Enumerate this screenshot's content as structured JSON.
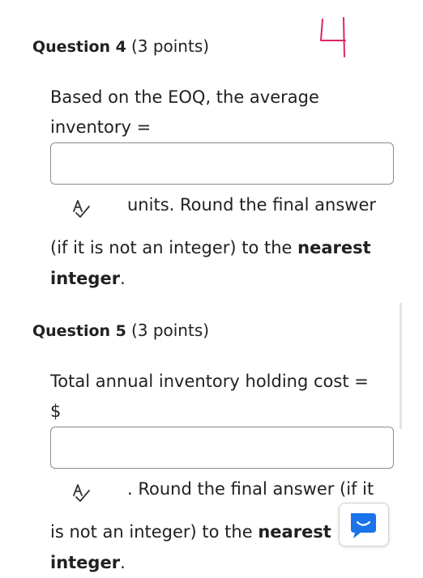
{
  "handwritten_mark": "4",
  "questions": [
    {
      "number_label": "Question 4",
      "points": "(3 points)",
      "prompt_line1": "Based on the EOQ, the average",
      "prompt_line2": "inventory =",
      "answer_value": "",
      "after_input": "units. Round the final answer",
      "cont_text": "(if it is not an integer) to the",
      "cont_bold": "nearest integer",
      "cont_end": "."
    },
    {
      "number_label": "Question 5",
      "points": "(3 points)",
      "prompt_line1": "Total annual inventory holding cost =",
      "prompt_line2": "$",
      "answer_value": "",
      "after_input": ". Round the final answer (if it",
      "cont_text": "is not an integer) to the",
      "cont_bold": "nearest integer",
      "cont_end": "."
    }
  ],
  "icons": {
    "spellcheck": "spellcheck-icon",
    "chat": "chat-icon"
  },
  "colors": {
    "text": "#202122",
    "handwritten": "#e0245e",
    "chat_accent": "#1a73e8"
  }
}
